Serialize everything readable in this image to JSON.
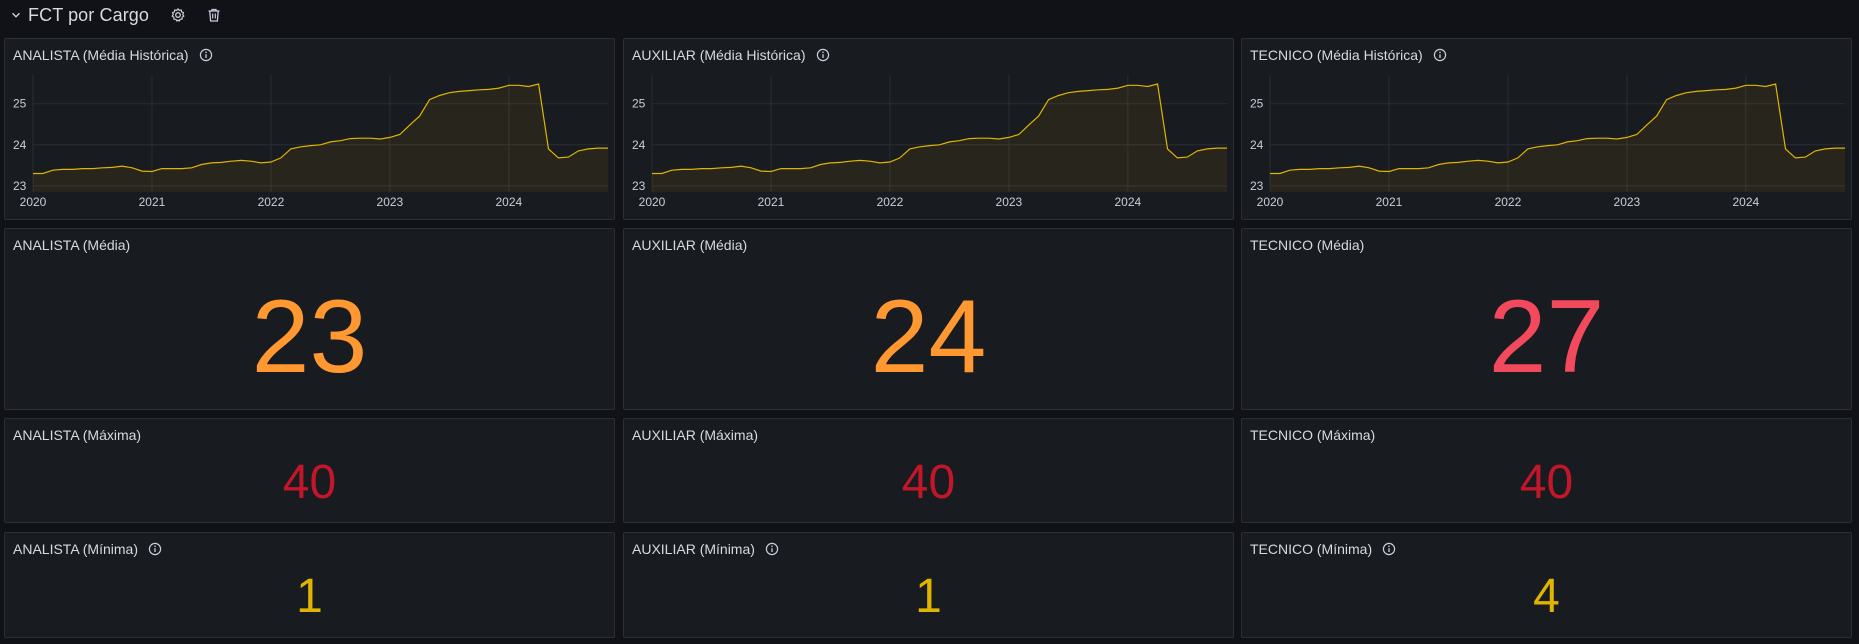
{
  "row": {
    "title": "FCT por Cargo",
    "icons": [
      "chevron-down-icon",
      "gear-icon",
      "trash-icon"
    ]
  },
  "colors": {
    "orange": "#ff9830",
    "red": "#f2495c",
    "dark_red": "#c4162a",
    "yellow": "#e0b400",
    "line": "#e0b400"
  },
  "timeseries": {
    "x_ticks": [
      "2020",
      "2021",
      "2022",
      "2023",
      "2024"
    ],
    "y_ticks": [
      "23",
      "24",
      "25"
    ]
  },
  "panels": {
    "analista": {
      "hist_title": "ANALISTA (Média Histórica)",
      "media_title": "ANALISTA (Média)",
      "media_value": "23",
      "media_color": "orange",
      "max_title": "ANALISTA (Máxima)",
      "max_value": "40",
      "min_title": "ANALISTA (Mínima)",
      "min_value": "1"
    },
    "auxiliar": {
      "hist_title": "AUXILIAR (Média Histórica)",
      "media_title": "AUXILIAR (Média)",
      "media_value": "24",
      "media_color": "orange",
      "max_title": "AUXILIAR (Máxima)",
      "max_value": "40",
      "min_title": "AUXILIAR (Mínima)",
      "min_value": "1"
    },
    "tecnico": {
      "hist_title": "TECNICO (Média Histórica)",
      "media_title": "TECNICO (Média)",
      "media_value": "27",
      "media_color": "red",
      "max_title": "TECNICO (Máxima)",
      "max_value": "40",
      "min_title": "TECNICO (Mínima)",
      "min_value": "4"
    }
  },
  "chart_data": {
    "type": "area",
    "title": "",
    "xlabel": "",
    "ylabel": "",
    "xlim": [
      "2020-01",
      "2024-11"
    ],
    "ylim": [
      22.85,
      25.7
    ],
    "x_ticks": [
      "2020",
      "2021",
      "2022",
      "2023",
      "2024"
    ],
    "y_ticks": [
      23,
      24,
      25
    ],
    "grid": true,
    "legend": "none",
    "x": [
      "2020-01",
      "2020-02",
      "2020-03",
      "2020-04",
      "2020-05",
      "2020-06",
      "2020-07",
      "2020-08",
      "2020-09",
      "2020-10",
      "2020-11",
      "2020-12",
      "2021-01",
      "2021-02",
      "2021-03",
      "2021-04",
      "2021-05",
      "2021-06",
      "2021-07",
      "2021-08",
      "2021-09",
      "2021-10",
      "2021-11",
      "2021-12",
      "2022-01",
      "2022-02",
      "2022-03",
      "2022-04",
      "2022-05",
      "2022-06",
      "2022-07",
      "2022-08",
      "2022-09",
      "2022-10",
      "2022-11",
      "2022-12",
      "2023-01",
      "2023-02",
      "2023-03",
      "2023-04",
      "2023-05",
      "2023-06",
      "2023-07",
      "2023-08",
      "2023-09",
      "2023-10",
      "2023-11",
      "2023-12",
      "2024-01",
      "2024-02",
      "2024-03",
      "2024-04",
      "2024-05",
      "2024-06",
      "2024-07",
      "2024-08",
      "2024-09",
      "2024-10",
      "2024-11"
    ],
    "series": [
      {
        "values": [
          23.3,
          23.3,
          23.38,
          23.4,
          23.4,
          23.42,
          23.42,
          23.44,
          23.45,
          23.48,
          23.44,
          23.36,
          23.35,
          23.42,
          23.42,
          23.42,
          23.44,
          23.52,
          23.56,
          23.57,
          23.6,
          23.62,
          23.6,
          23.56,
          23.58,
          23.68,
          23.9,
          23.95,
          23.98,
          24.0,
          24.07,
          24.1,
          24.15,
          24.16,
          24.16,
          24.14,
          24.18,
          24.25,
          24.48,
          24.7,
          25.1,
          25.2,
          25.27,
          25.3,
          25.32,
          25.34,
          25.35,
          25.38,
          25.45,
          25.45,
          25.42,
          25.48,
          23.9,
          23.68,
          23.7,
          23.85,
          23.9,
          23.92,
          23.92
        ]
      }
    ]
  }
}
